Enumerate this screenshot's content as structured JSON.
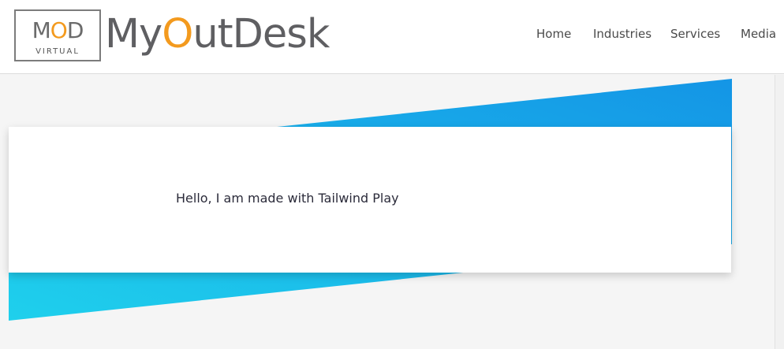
{
  "logo": {
    "mod_prefix": "M",
    "mod_o": "O",
    "mod_suffix": "D",
    "virtual": "VIRTUAL"
  },
  "brand": {
    "part1": "My",
    "o": "O",
    "part2": "utDesk",
    "accent_color": "#f39a1e",
    "text_color": "#5f5f62"
  },
  "nav": {
    "items": [
      "Home",
      "Industries",
      "Services",
      "Media"
    ]
  },
  "card": {
    "text": "Hello, I am made with Tailwind Play"
  },
  "colors": {
    "gradient_start": "#1fd0ec",
    "gradient_end": "#1495e6",
    "background": "#f5f5f5"
  }
}
